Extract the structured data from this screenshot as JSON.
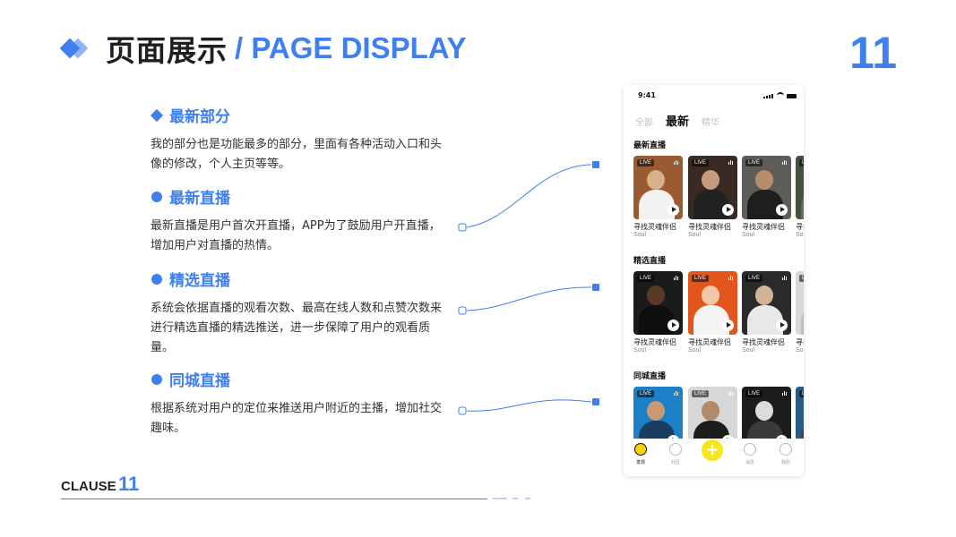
{
  "header": {
    "title_zh": "页面展示",
    "title_en": "/ PAGE DISPLAY",
    "page_number": "11"
  },
  "sections": [
    {
      "title": "最新部分",
      "bullet": "diamond",
      "body": "我的部分也是功能最多的部分，里面有各种活动入口和头像的修改，个人主页等等。"
    },
    {
      "title": "最新直播",
      "bullet": "circle",
      "body": "最新直播是用户首次开直播，APP为了鼓励用户开直播，增加用户对直播的热情。"
    },
    {
      "title": "精选直播",
      "bullet": "circle",
      "body": "系统会依据直播的观看次数、最高在线人数和点赞次数来进行精选直播的精选推送，进一步保障了用户的观看质量。"
    },
    {
      "title": "同城直播",
      "bullet": "circle",
      "body": "根据系统对用户的定位来推送用户附近的主播，增加社交趣味。"
    }
  ],
  "footer": {
    "label": "CLAUSE",
    "number": "11"
  },
  "phone": {
    "time": "9:41",
    "tabs": [
      {
        "label": "全部",
        "active": false
      },
      {
        "label": "最新",
        "active": true
      },
      {
        "label": "精华",
        "active": false
      }
    ],
    "rows": [
      {
        "label": "最新直播",
        "cards": [
          {
            "badge": "LIVE",
            "title": "寻找灵魂伴侣",
            "subtitle": "Soul",
            "bg": "#9a5a32",
            "skin": "#d9b08c",
            "cloth": "#f2f2f2"
          },
          {
            "badge": "LIVE",
            "title": "寻找灵魂伴侣",
            "subtitle": "Soul",
            "bg": "#3a2a24",
            "skin": "#c89a7c",
            "cloth": "#222222"
          },
          {
            "badge": "LIVE",
            "title": "寻找灵魂伴侣",
            "subtitle": "Soul",
            "bg": "#5e5d5a",
            "skin": "#b98c6a",
            "cloth": "#1e1e1e"
          },
          {
            "badge": "LIVE",
            "title": "寻找灵魂伴侣",
            "subtitle": "Soul",
            "bg": "#45503e",
            "skin": "#c6a07e",
            "cloth": "#6b6b5e"
          }
        ]
      },
      {
        "label": "精选直播",
        "cards": [
          {
            "badge": "LIVE",
            "title": "寻找灵魂伴侣",
            "subtitle": "Soul",
            "bg": "#1b1b1b",
            "skin": "#5a3a26",
            "cloth": "#0e0e0e"
          },
          {
            "badge": "LIVE",
            "title": "寻找灵魂伴侣",
            "subtitle": "Soul",
            "bg": "#e2561e",
            "skin": "#f0c8a6",
            "cloth": "#f4f4f4"
          },
          {
            "badge": "LIVE",
            "title": "寻找灵魂伴侣",
            "subtitle": "Soul",
            "bg": "#2a2a2a",
            "skin": "#d0b498",
            "cloth": "#e8e8e8"
          },
          {
            "badge": "LIVE",
            "title": "寻找灵魂伴侣",
            "subtitle": "Soul",
            "bg": "#d8d8d8",
            "skin": "#9a7a60",
            "cloth": "#bdbdbd"
          }
        ]
      },
      {
        "label": "同城直播",
        "cards": [
          {
            "badge": "LIVE",
            "title": "",
            "subtitle": "",
            "bg": "#1e7fc9",
            "skin": "#c99a72",
            "cloth": "#1a3e60"
          },
          {
            "badge": "LIVE",
            "title": "",
            "subtitle": "",
            "bg": "#d7d7d7",
            "skin": "#b08a6a",
            "cloth": "#1c1c1c"
          },
          {
            "badge": "LIVE",
            "title": "",
            "subtitle": "",
            "bg": "#1c1c1c",
            "skin": "#dcdcdc",
            "cloth": "#3a3a3a"
          },
          {
            "badge": "LIVE",
            "title": "",
            "subtitle": "",
            "bg": "#2a5a86",
            "skin": "#c2a88c",
            "cloth": "#444444"
          }
        ]
      }
    ],
    "nav": [
      {
        "label": "发现",
        "icon": "discover-icon",
        "active": true
      },
      {
        "label": "社区",
        "icon": "community-icon",
        "active": false
      },
      {
        "label": "",
        "icon": "plus-icon",
        "active": false
      },
      {
        "label": "消息",
        "icon": "message-icon",
        "active": false
      },
      {
        "label": "我的",
        "icon": "profile-icon",
        "active": false
      }
    ]
  },
  "colors": {
    "accent": "#3f7ff0",
    "plus_button": "#f8e51a",
    "discover_active": "#f5d20b"
  }
}
